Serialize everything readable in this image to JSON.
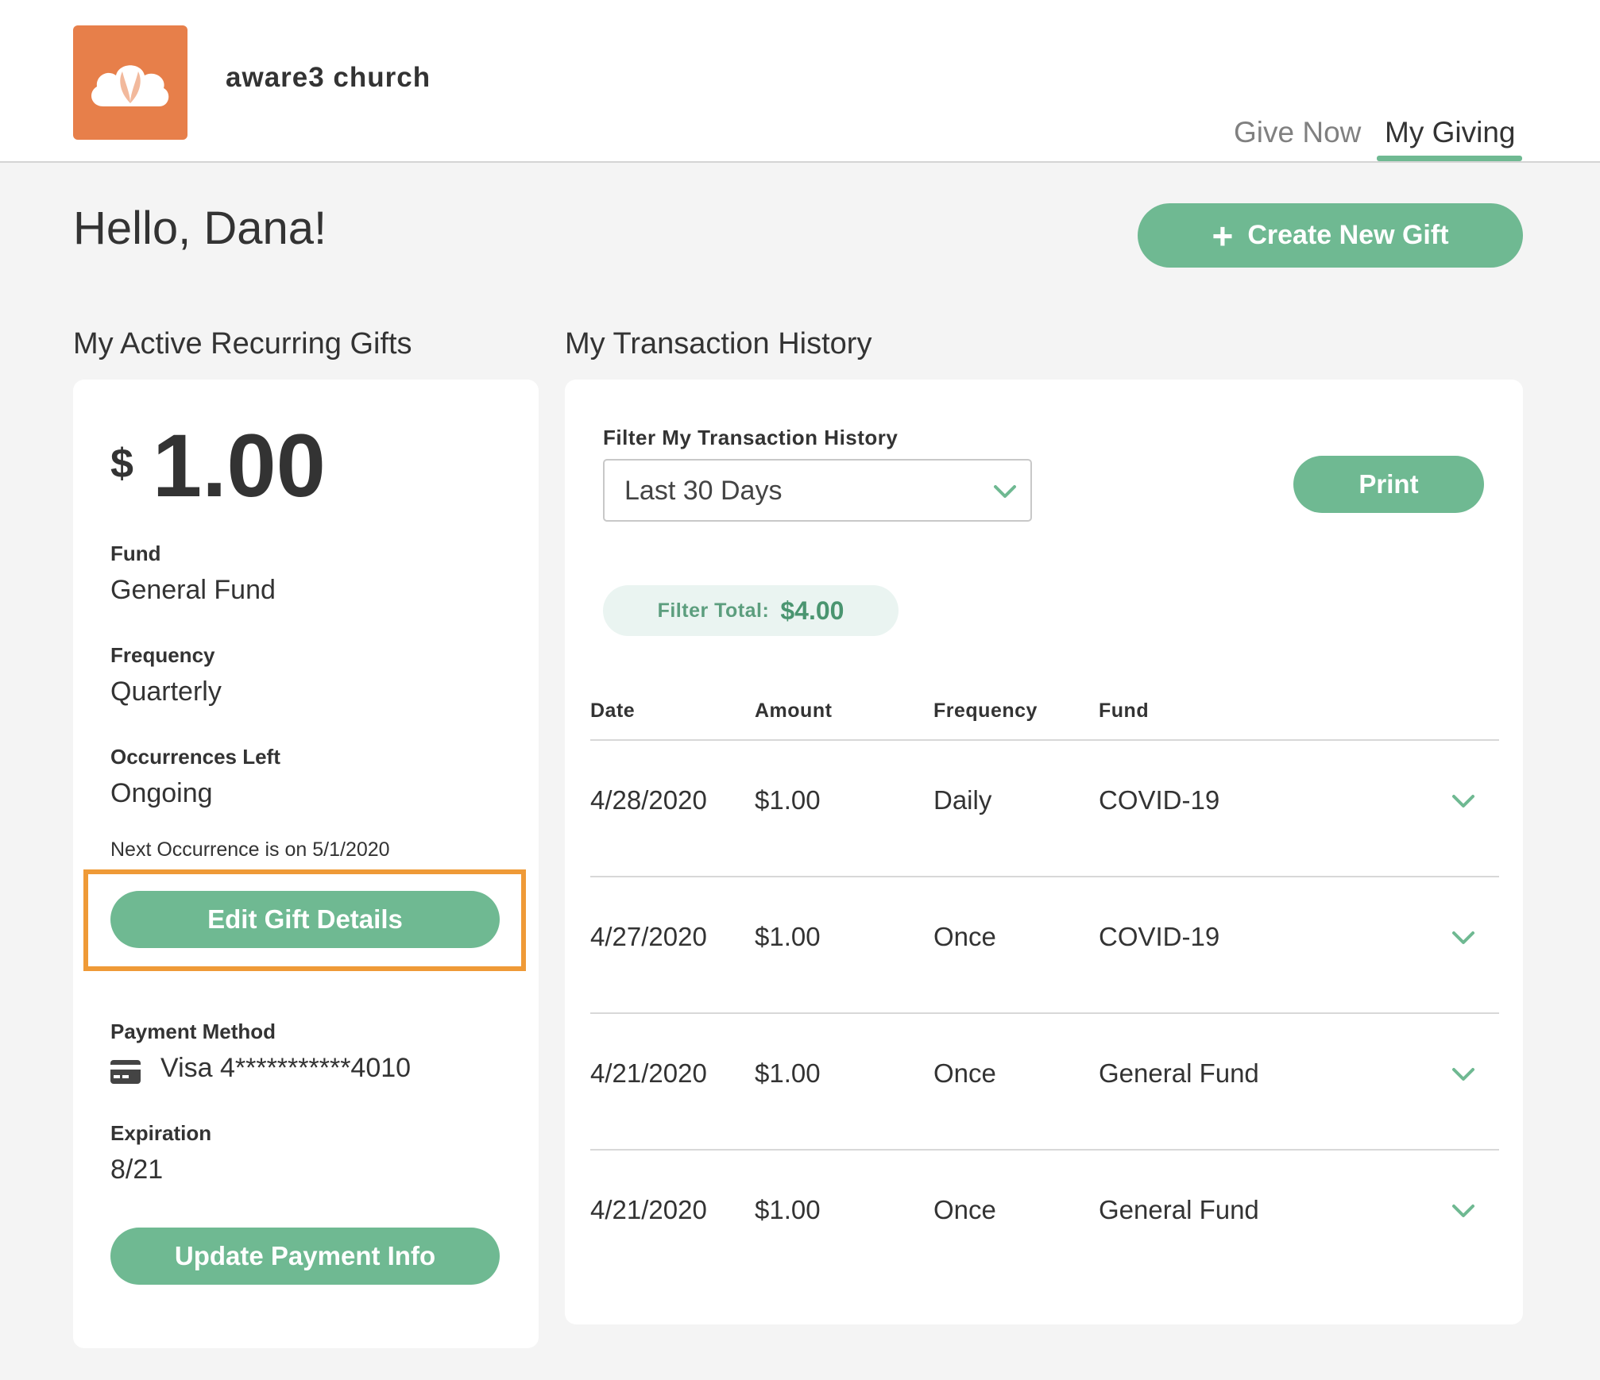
{
  "header": {
    "org_name": "aware3 church",
    "nav": {
      "give_now": "Give Now",
      "my_giving": "My Giving"
    }
  },
  "greeting": "Hello, Dana!",
  "create_gift_label": "Create New Gift",
  "recurring": {
    "title": "My Active Recurring Gifts",
    "currency_symbol": "$",
    "amount": "1.00",
    "fund_label": "Fund",
    "fund_value": "General Fund",
    "frequency_label": "Frequency",
    "frequency_value": "Quarterly",
    "occurrences_label": "Occurrences Left",
    "occurrences_value": "Ongoing",
    "next_occurrence": "Next Occurrence is on 5/1/2020",
    "edit_label": "Edit Gift Details",
    "payment_label": "Payment Method",
    "payment_value": "Visa 4***********4010",
    "expiration_label": "Expiration",
    "expiration_value": "8/21",
    "update_label": "Update Payment Info"
  },
  "history": {
    "title": "My Transaction History",
    "filter_label": "Filter My Transaction History",
    "filter_value": "Last 30 Days",
    "print_label": "Print",
    "total_label": "Filter Total:",
    "total_value": "$4.00",
    "columns": [
      "Date",
      "Amount",
      "Frequency",
      "Fund"
    ],
    "rows": [
      {
        "date": "4/28/2020",
        "amount": "$1.00",
        "frequency": "Daily",
        "fund": "COVID-19"
      },
      {
        "date": "4/27/2020",
        "amount": "$1.00",
        "frequency": "Once",
        "fund": "COVID-19"
      },
      {
        "date": "4/21/2020",
        "amount": "$1.00",
        "frequency": "Once",
        "fund": "General Fund"
      },
      {
        "date": "4/21/2020",
        "amount": "$1.00",
        "frequency": "Once",
        "fund": "General Fund"
      }
    ]
  },
  "colors": {
    "accent_green": "#6fb992",
    "logo_orange": "#e77f4a",
    "highlight_orange": "#ef9a37"
  }
}
